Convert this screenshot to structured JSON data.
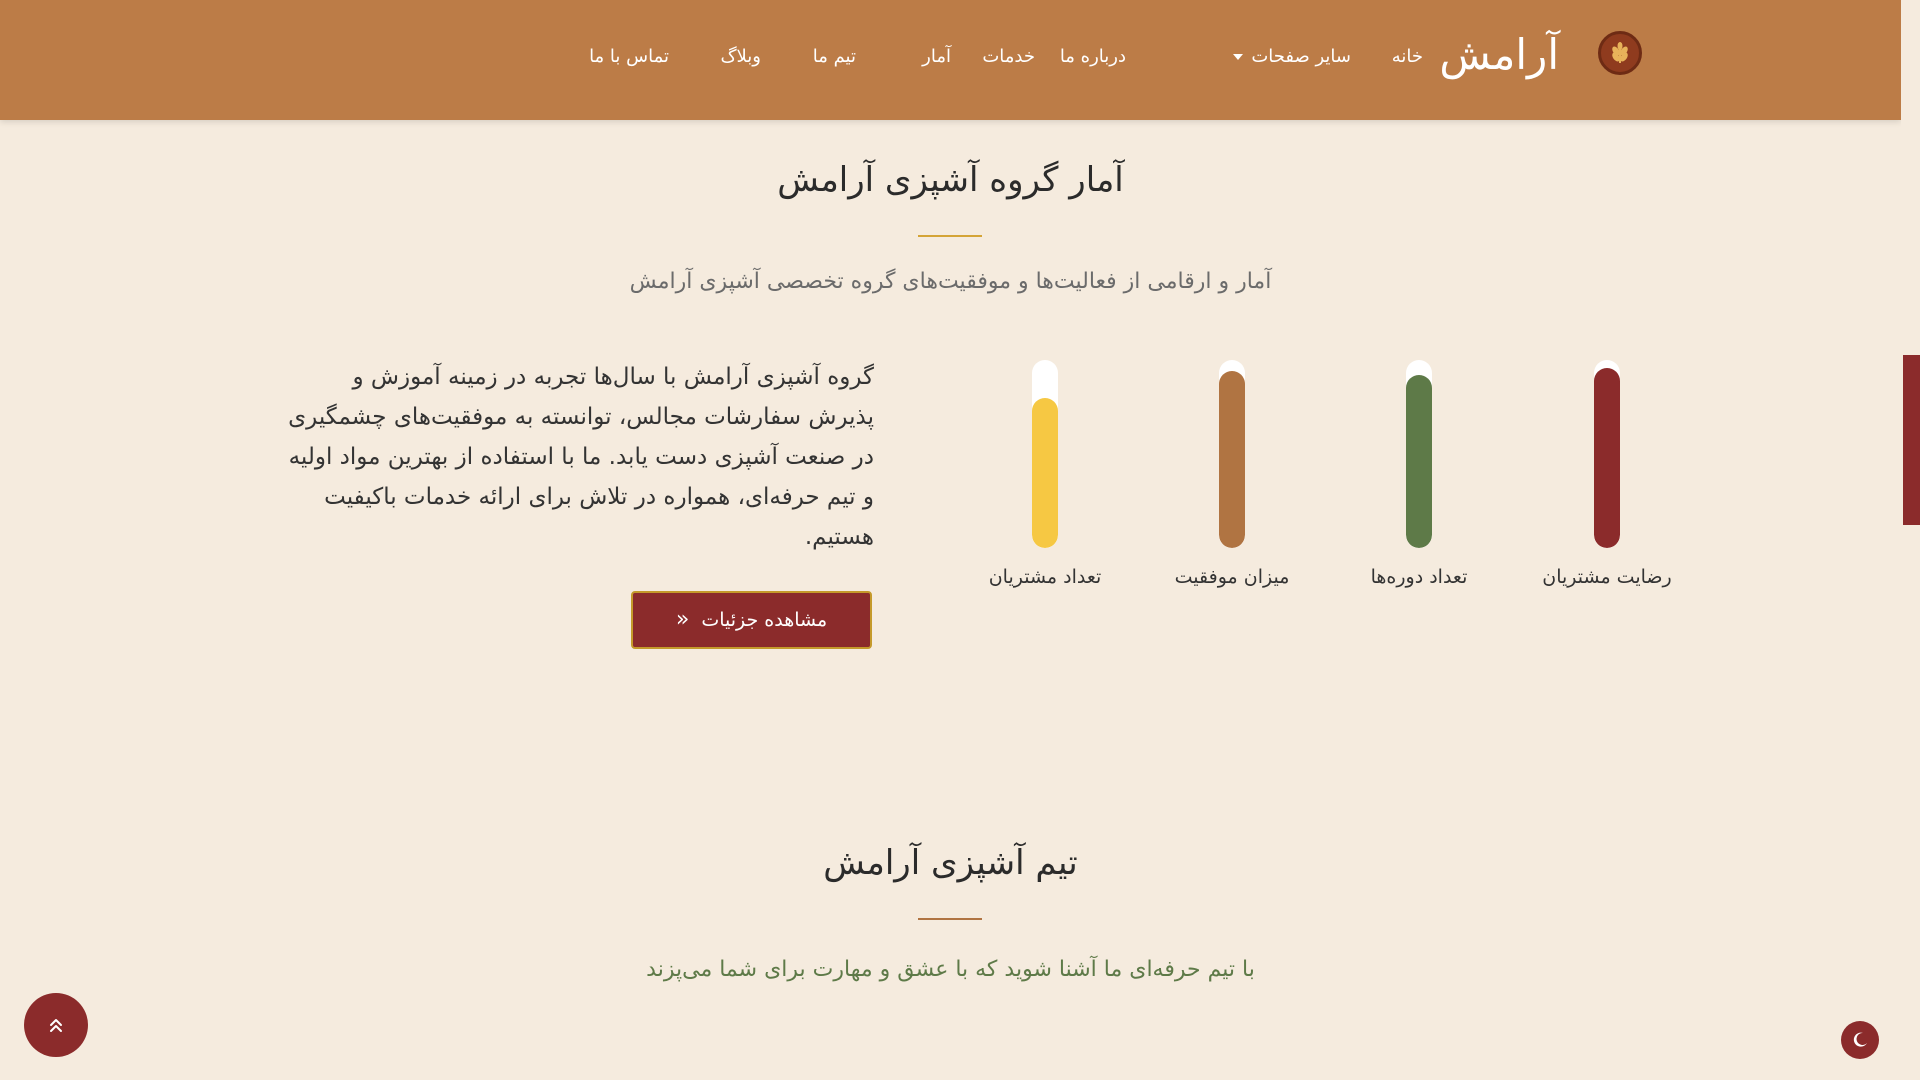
{
  "header": {
    "brand": "آرامش",
    "nav": {
      "home": "خانه",
      "other_pages": "سایر صفحات",
      "about": "درباره ما",
      "services": "خدمات",
      "stats": "آمار",
      "team": "تیم ما",
      "blog": "وبلاگ",
      "contact": "تماس با ما"
    },
    "logo_icon": "wheat-logo-icon"
  },
  "stats_section": {
    "title": "آمار گروه آشپزی آرامش",
    "subtitle": "آمار و ارقامی از فعالیت‌ها و موفقیت‌های گروه تخصصی آشپزی آرامش",
    "description": "گروه آشپزی آرامش با سال‌ها تجربه در زمینه آموزش و پذیرش سفارشات مجالس، توانسته به موفقیت‌های چشمگیری در صنعت آشپزی دست یابد. ما با استفاده از بهترین مواد اولیه و تیم حرفه‌ای، همواره در تلاش برای ارائه خدمات باکیفیت هستیم.",
    "button_label": "مشاهده جزئیات",
    "divider_color": "#d4a437",
    "subtitle_color": "#6b6b6b"
  },
  "chart_data": {
    "type": "bar",
    "categories": [
      "رضایت مشتریان",
      "تعداد دوره‌ها",
      "میزان موفقیت",
      "تعداد مشتریان"
    ],
    "values": [
      0.96,
      0.92,
      0.94,
      0.8
    ],
    "ylim": [
      0,
      1
    ],
    "colors": [
      "#8b2b2b",
      "#5e7a48",
      "#b07442",
      "#f6c843"
    ],
    "track_color": "#ffffff"
  },
  "team_section": {
    "title": "تیم آشپزی آرامش",
    "subtitle": "با تیم حرفه‌ای ما آشنا شوید که با عشق و مهارت برای شما می‌پزند",
    "divider_color": "#b07442",
    "subtitle_color": "#5e7a48"
  },
  "floating": {
    "scroll_top_icon": "double-chevron-up-icon",
    "theme_icon": "moon-icon"
  },
  "colors": {
    "header_bg": "#bc7c47",
    "page_bg": "#f5ebde",
    "accent": "#8b2b2b"
  }
}
